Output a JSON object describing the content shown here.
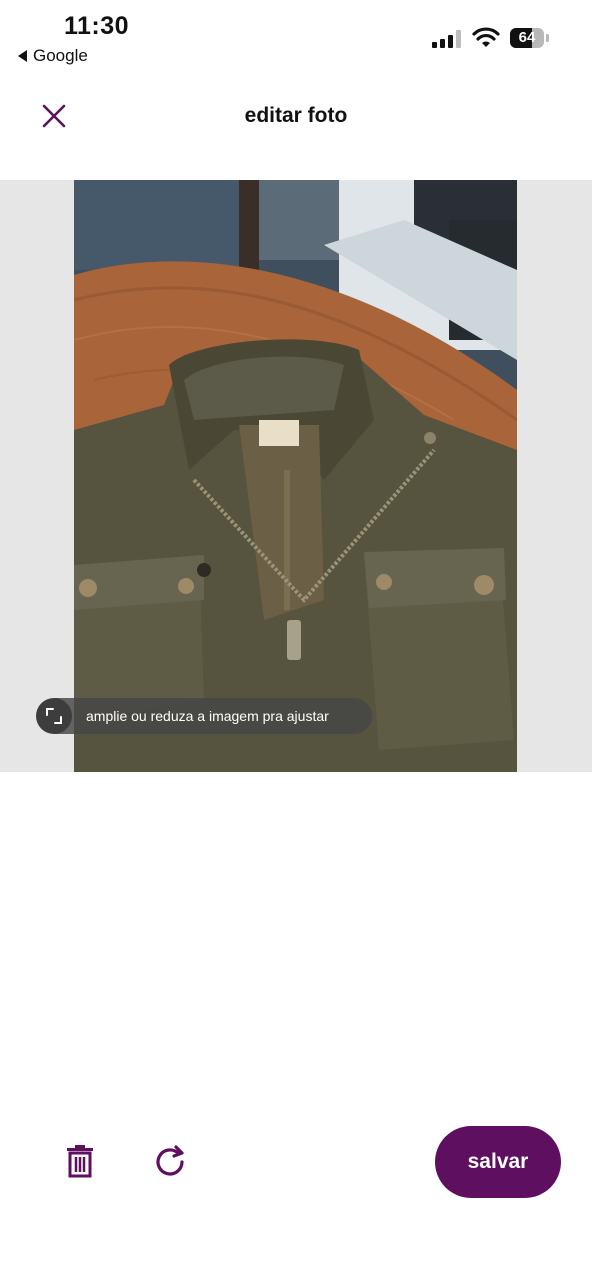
{
  "status_bar": {
    "time": "11:30",
    "back_app": "Google",
    "battery": "64"
  },
  "header": {
    "title": "editar foto",
    "close_icon": "close-icon"
  },
  "editor": {
    "photo_label": "photo of olive green jacket on wooden table",
    "hint_text": "amplie ou reduza a imagem pra ajustar",
    "hint_icon": "resize-icon"
  },
  "actions": {
    "delete_icon": "trash-icon",
    "rotate_icon": "rotate-icon",
    "save_label": "salvar"
  },
  "colors": {
    "brand": "#5e0f5f",
    "editor_bg": "#e6e6e6"
  }
}
